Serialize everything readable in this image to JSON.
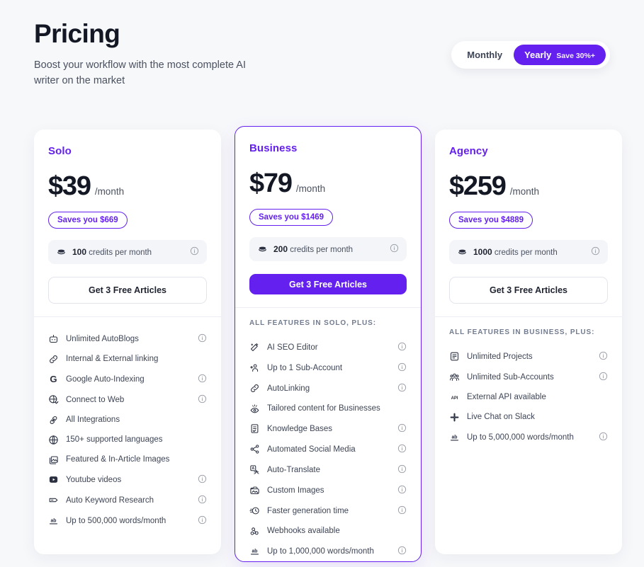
{
  "header": {
    "title": "Pricing",
    "subtitle": "Boost your workflow with the most complete AI writer on the market",
    "billing": {
      "monthly_label": "Monthly",
      "yearly_label": "Yearly",
      "yearly_save_label": "Save 30%+",
      "active": "Yearly"
    }
  },
  "colors": {
    "accent": "#6320ee",
    "page_bg": "#f7f8fa",
    "card_bg": "#ffffff",
    "text": "#1f2330"
  },
  "plans": [
    {
      "name": "Solo",
      "price": "$39",
      "period": "/month",
      "saves": "Saves you $669",
      "credits_amount": "100",
      "credits_label": "credits per month",
      "cta": "Get 3 Free Articles",
      "highlighted": false,
      "features_heading": "",
      "features": [
        {
          "label": "Unlimited AutoBlogs",
          "icon": "robot-icon",
          "info": true
        },
        {
          "label": "Internal & External linking",
          "icon": "link-icon",
          "info": false
        },
        {
          "label": "Google Auto-Indexing",
          "icon": "google-icon",
          "info": true
        },
        {
          "label": "Connect to Web",
          "icon": "globe-check-icon",
          "info": true
        },
        {
          "label": "All Integrations",
          "icon": "plug-icon",
          "info": false
        },
        {
          "label": "150+ supported languages",
          "icon": "globe-icon",
          "info": false
        },
        {
          "label": "Featured & In-Article Images",
          "icon": "images-icon",
          "info": false
        },
        {
          "label": "Youtube videos",
          "icon": "youtube-icon",
          "info": true
        },
        {
          "label": "Auto Keyword Research",
          "icon": "tag-icon",
          "info": true
        },
        {
          "label": "Up to 500,000 words/month",
          "icon": "ab-words-icon",
          "info": true
        }
      ]
    },
    {
      "name": "Business",
      "price": "$79",
      "period": "/month",
      "saves": "Saves you $1469",
      "credits_amount": "200",
      "credits_label": "credits per month",
      "cta": "Get 3 Free Articles",
      "highlighted": true,
      "features_heading": "ALL FEATURES IN SOLO, PLUS:",
      "features": [
        {
          "label": "AI SEO Editor",
          "icon": "magic-wand-icon",
          "info": true
        },
        {
          "label": "Up to 1 Sub-Account",
          "icon": "users-add-icon",
          "info": true
        },
        {
          "label": "AutoLinking",
          "icon": "link-icon",
          "info": true
        },
        {
          "label": "Tailored content for Businesses",
          "icon": "eye-idea-icon",
          "info": false
        },
        {
          "label": "Knowledge Bases",
          "icon": "document-check-icon",
          "info": true
        },
        {
          "label": "Automated Social Media",
          "icon": "share-icon",
          "info": true
        },
        {
          "label": "Auto-Translate",
          "icon": "translate-icon",
          "info": true
        },
        {
          "label": "Custom Images",
          "icon": "image-upload-icon",
          "info": true
        },
        {
          "label": "Faster generation time",
          "icon": "fast-clock-icon",
          "info": true
        },
        {
          "label": "Webhooks available",
          "icon": "webhook-icon",
          "info": false
        },
        {
          "label": "Up to 1,000,000 words/month",
          "icon": "ab-words-icon",
          "info": true
        }
      ]
    },
    {
      "name": "Agency",
      "price": "$259",
      "period": "/month",
      "saves": "Saves you $4889",
      "credits_amount": "1000",
      "credits_label": "credits per month",
      "cta": "Get 3 Free Articles",
      "highlighted": false,
      "features_heading": "ALL FEATURES IN BUSINESS, PLUS:",
      "features": [
        {
          "label": "Unlimited Projects",
          "icon": "document-list-icon",
          "info": true
        },
        {
          "label": "Unlimited Sub-Accounts",
          "icon": "users-icon",
          "info": true
        },
        {
          "label": "External API available",
          "icon": "api-icon",
          "info": false
        },
        {
          "label": "Live Chat on Slack",
          "icon": "slack-icon",
          "info": false
        },
        {
          "label": "Up to 5,000,000 words/month",
          "icon": "ab-words-icon",
          "info": true
        }
      ]
    }
  ]
}
